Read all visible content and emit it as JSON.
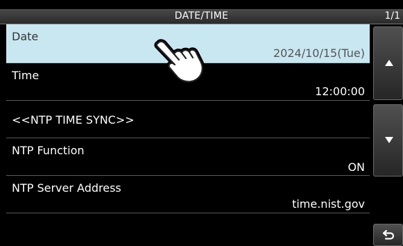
{
  "header": {
    "title": "DATE/TIME",
    "page_indicator": "1/1"
  },
  "items": [
    {
      "label": "Date",
      "value": "2024/10/15(Tue)"
    },
    {
      "label": "Time",
      "value": "12:00:00"
    },
    {
      "label": "<<NTP TIME SYNC>>",
      "value": ""
    },
    {
      "label": "NTP Function",
      "value": "ON"
    },
    {
      "label": "NTP Server Address",
      "value": "time.nist.gov"
    }
  ],
  "icons": {
    "scroll_up": "triangle-up-icon",
    "scroll_down": "triangle-down-icon",
    "back": "return-arrow-icon",
    "pointer": "touch-hand-icon"
  },
  "colors": {
    "background": "#000000",
    "selected_row": "#c9e7f1",
    "text": "#ffffff"
  }
}
